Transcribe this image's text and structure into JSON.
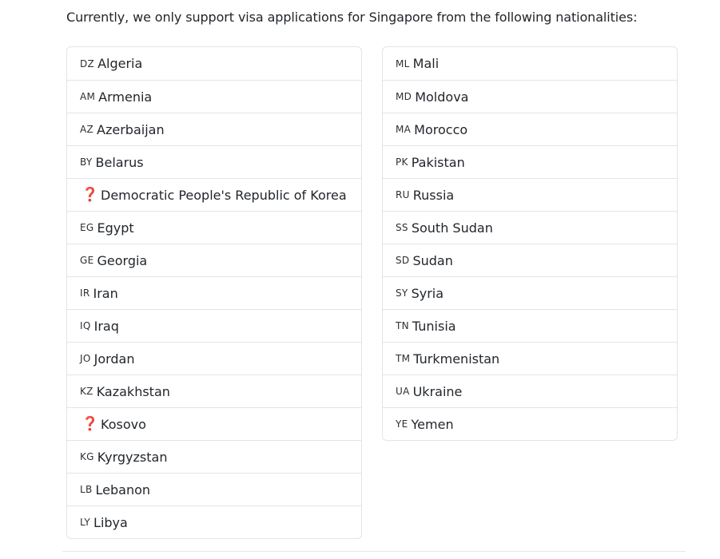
{
  "intro": "Currently, we only support visa applications for Singapore from the following nationalities:",
  "left": [
    {
      "code": "DZ",
      "name": "Algeria"
    },
    {
      "code": "AM",
      "name": "Armenia"
    },
    {
      "code": "AZ",
      "name": "Azerbaijan"
    },
    {
      "code": "BY",
      "name": "Belarus"
    },
    {
      "code": "❓",
      "name": "Democratic People's Republic of Korea"
    },
    {
      "code": "EG",
      "name": "Egypt"
    },
    {
      "code": "GE",
      "name": "Georgia"
    },
    {
      "code": "IR",
      "name": "Iran"
    },
    {
      "code": "IQ",
      "name": "Iraq"
    },
    {
      "code": "JO",
      "name": "Jordan"
    },
    {
      "code": "KZ",
      "name": "Kazakhstan"
    },
    {
      "code": "❓",
      "name": "Kosovo"
    },
    {
      "code": "KG",
      "name": "Kyrgyzstan"
    },
    {
      "code": "LB",
      "name": "Lebanon"
    },
    {
      "code": "LY",
      "name": "Libya"
    }
  ],
  "right": [
    {
      "code": "ML",
      "name": "Mali"
    },
    {
      "code": "MD",
      "name": "Moldova"
    },
    {
      "code": "MA",
      "name": "Morocco"
    },
    {
      "code": "PK",
      "name": "Pakistan"
    },
    {
      "code": "RU",
      "name": "Russia"
    },
    {
      "code": "SS",
      "name": "South Sudan"
    },
    {
      "code": "SD",
      "name": "Sudan"
    },
    {
      "code": "SY",
      "name": "Syria"
    },
    {
      "code": "TN",
      "name": "Tunisia"
    },
    {
      "code": "TM",
      "name": "Turkmenistan"
    },
    {
      "code": "UA",
      "name": "Ukraine"
    },
    {
      "code": "YE",
      "name": "Yemen"
    }
  ],
  "colors": {
    "border": "#e2e4e8",
    "text": "#22262b",
    "unknown_flag": "#e0245e"
  }
}
